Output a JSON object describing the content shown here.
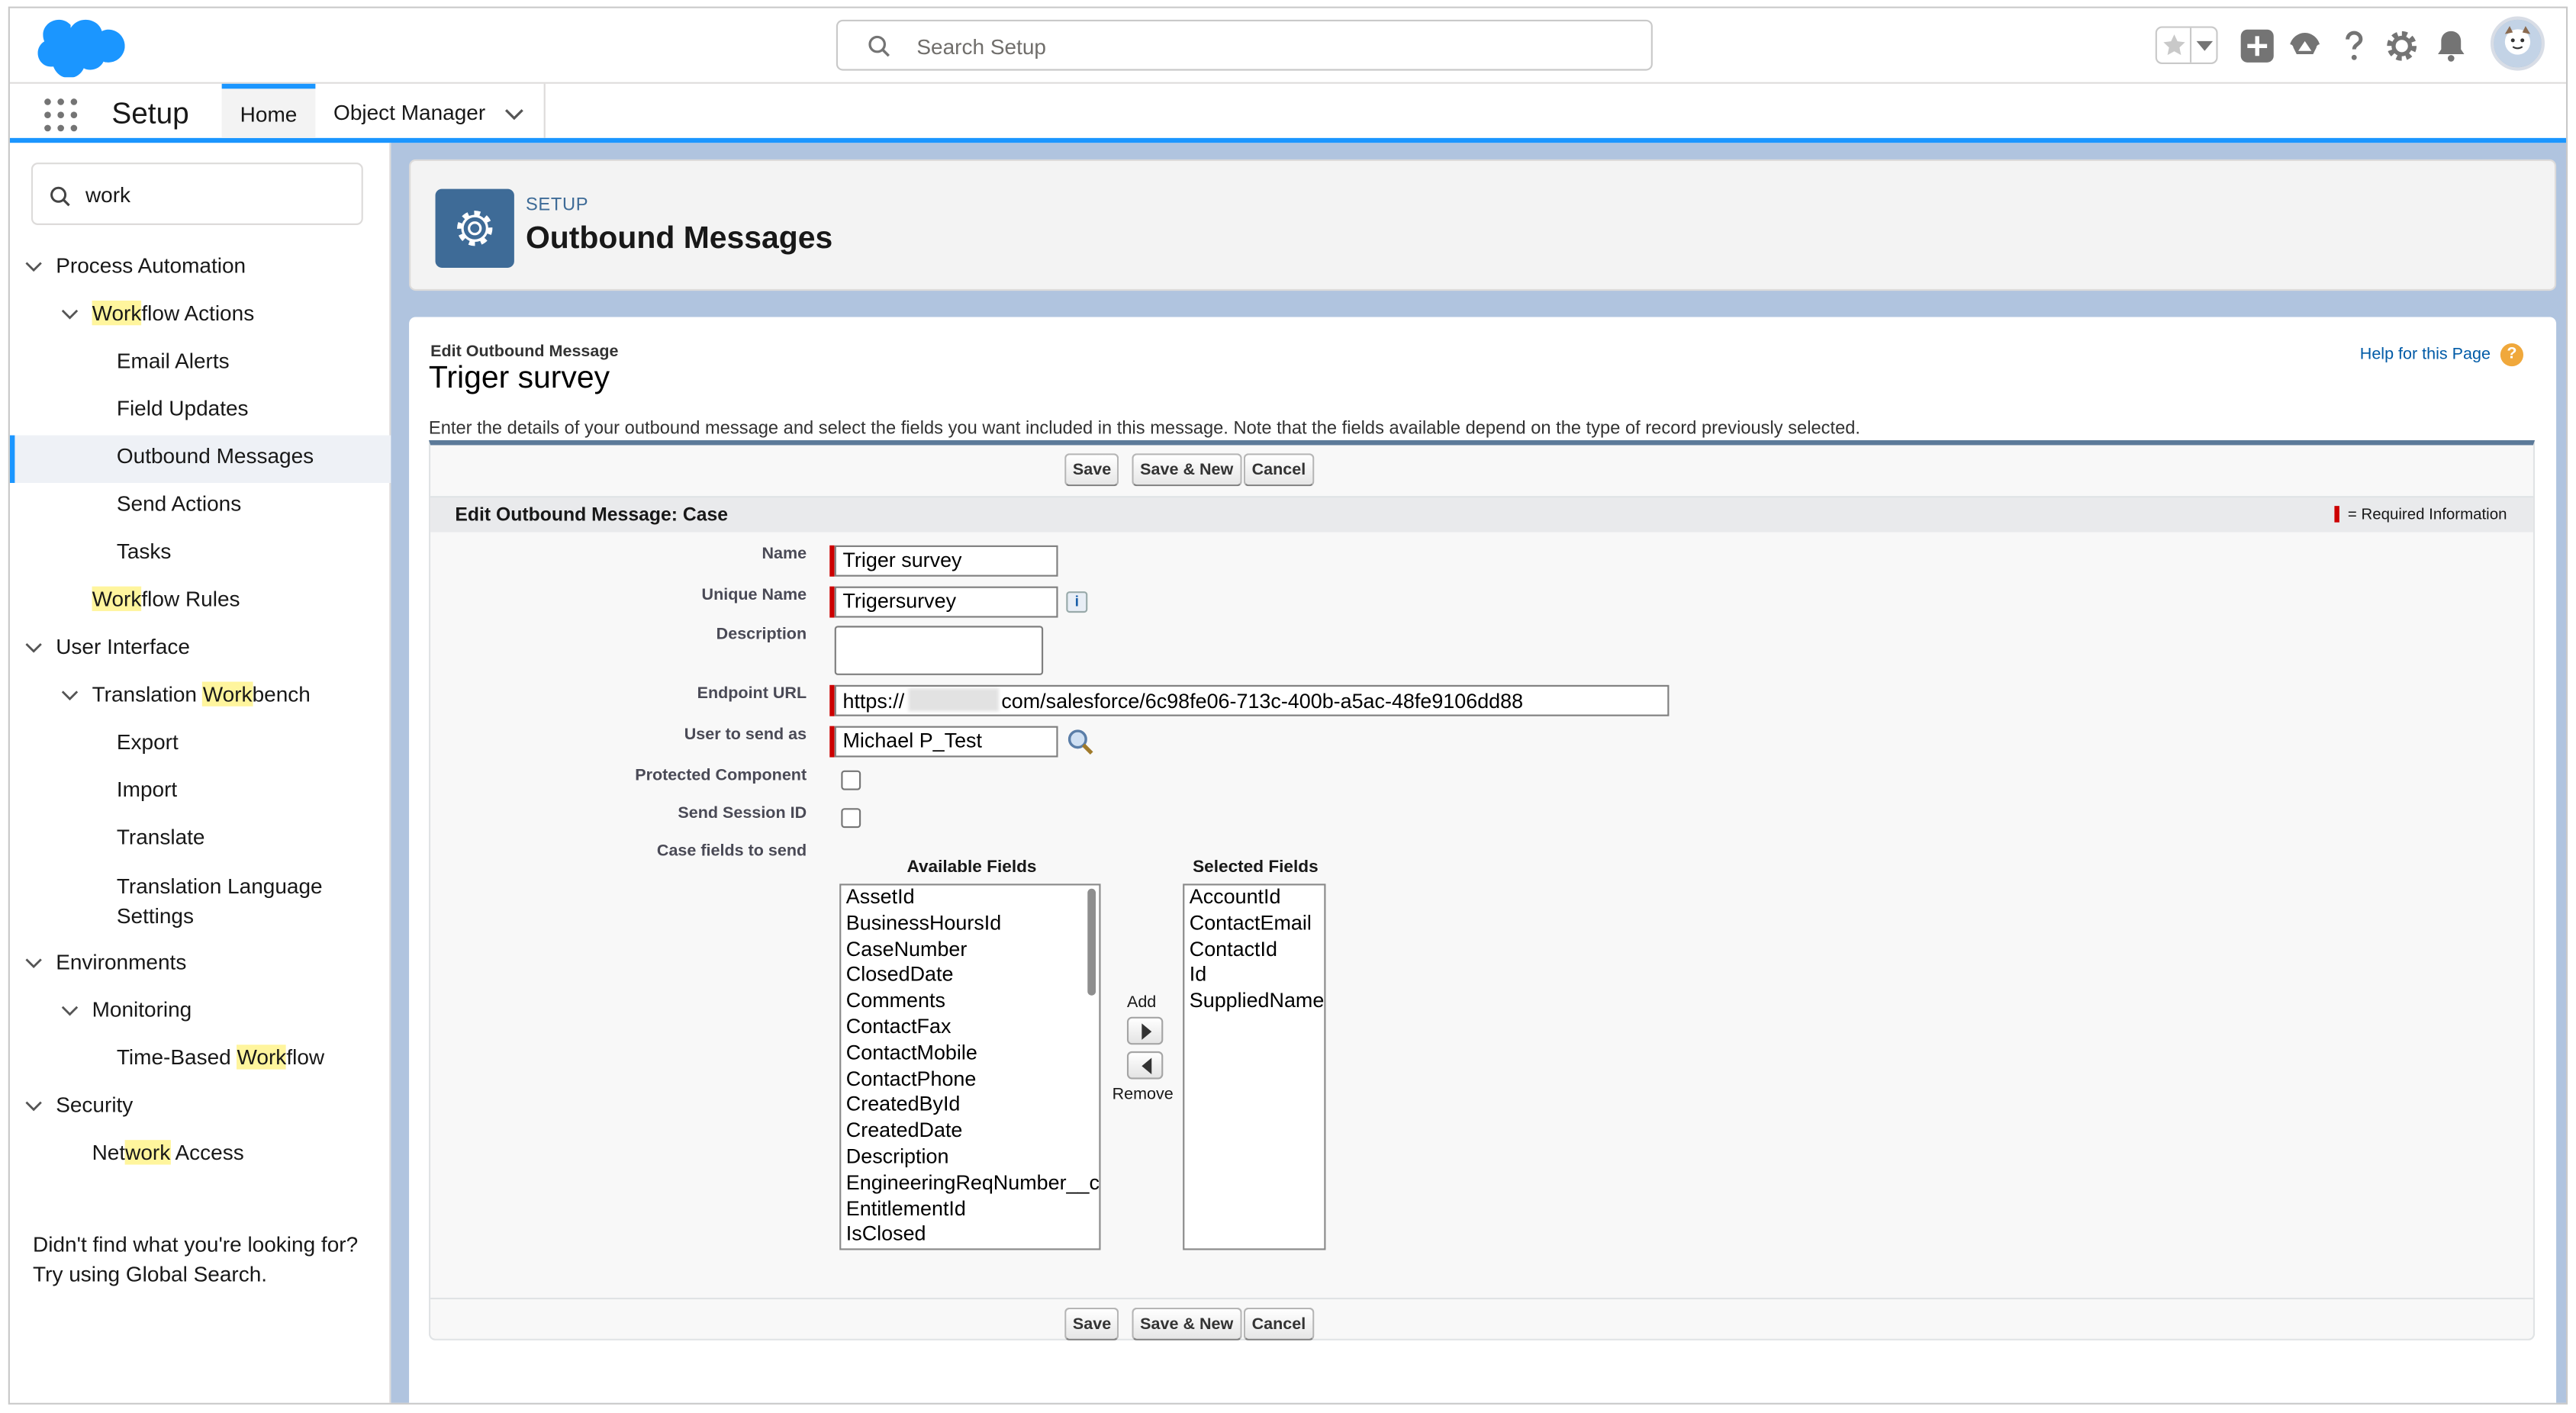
{
  "global_header": {
    "search_placeholder": "Search Setup"
  },
  "app_nav": {
    "app_name": "Setup",
    "tabs": [
      {
        "label": "Home",
        "active": true
      },
      {
        "label": "Object Manager",
        "active": false
      }
    ]
  },
  "sidebar": {
    "quick_find_value": "work",
    "tree": [
      {
        "id": "process-automation",
        "pre": "Process Automation",
        "hl": "",
        "post": "",
        "level": 0,
        "expanded": true
      },
      {
        "id": "workflow-actions",
        "pre": "",
        "hl": "Work",
        "post": "flow Actions",
        "level": 1,
        "expanded": true
      },
      {
        "id": "email-alerts",
        "pre": "Email Alerts",
        "hl": "",
        "post": "",
        "level": 2
      },
      {
        "id": "field-updates",
        "pre": "Field Updates",
        "hl": "",
        "post": "",
        "level": 2
      },
      {
        "id": "outbound-messages",
        "pre": "Outbound Messages",
        "hl": "",
        "post": "",
        "level": 2,
        "active": true
      },
      {
        "id": "send-actions",
        "pre": "Send Actions",
        "hl": "",
        "post": "",
        "level": 2
      },
      {
        "id": "tasks",
        "pre": "Tasks",
        "hl": "",
        "post": "",
        "level": 2
      },
      {
        "id": "workflow-rules",
        "pre": "",
        "hl": "Work",
        "post": "flow Rules",
        "level": 1
      },
      {
        "id": "user-interface",
        "pre": "User Interface",
        "hl": "",
        "post": "",
        "level": 0,
        "expanded": true
      },
      {
        "id": "translation-workbench",
        "pre": "Translation ",
        "hl": "Work",
        "post": "bench",
        "level": 1,
        "expanded": true
      },
      {
        "id": "export",
        "pre": "Export",
        "hl": "",
        "post": "",
        "level": 2
      },
      {
        "id": "import",
        "pre": "Import",
        "hl": "",
        "post": "",
        "level": 2
      },
      {
        "id": "translate",
        "pre": "Translate",
        "hl": "",
        "post": "",
        "level": 2
      },
      {
        "id": "translation-language-settings",
        "pre": "Translation Language",
        "hl": "",
        "post": "",
        "line2": "Settings",
        "level": 2
      },
      {
        "id": "environments",
        "pre": "Environments",
        "hl": "",
        "post": "",
        "level": 0,
        "expanded": true
      },
      {
        "id": "monitoring",
        "pre": "Monitoring",
        "hl": "",
        "post": "",
        "level": 1,
        "expanded": true
      },
      {
        "id": "time-based-workflow",
        "pre": "Time-Based ",
        "hl": "Work",
        "post": "flow",
        "level": 2
      },
      {
        "id": "security",
        "pre": "Security",
        "hl": "",
        "post": "",
        "level": 0,
        "expanded": true
      },
      {
        "id": "network-access",
        "pre": "Net",
        "hl": "work",
        "post": " Access",
        "level": 1
      }
    ],
    "footer_line1": "Didn't find what you're looking for?",
    "footer_line2": "Try using Global Search."
  },
  "page_header": {
    "crumb": "SETUP",
    "title": "Outbound Messages"
  },
  "content": {
    "pretitle": "Edit Outbound Message",
    "record_title": "Triger survey",
    "help_link": "Help for this Page",
    "help_icon": "?",
    "intro": "Enter the details of your outbound message and select the fields you want included in this message. Note that the fields available depend on the type of record previously selected.",
    "buttons": {
      "save": "Save",
      "save_new": "Save & New",
      "cancel": "Cancel"
    },
    "section_title": "Edit Outbound Message: Case",
    "required_legend": "= Required Information",
    "fields": {
      "name_label": "Name",
      "name_value": "Triger survey",
      "unique_name_label": "Unique Name",
      "unique_name_value": "Trigersurvey",
      "unique_name_info": "i",
      "description_label": "Description",
      "description_value": "",
      "endpoint_label": "Endpoint URL",
      "endpoint_prefix": "https://",
      "endpoint_suffix": "com/salesforce/6c98fe06-713c-400b-a5ac-48fe9106dd88",
      "user_label": "User to send as",
      "user_value": "Michael P_Test",
      "protected_label": "Protected Component",
      "protected_checked": false,
      "session_label": "Send Session ID",
      "session_checked": false,
      "case_fields_label": "Case fields to send"
    },
    "available_fields_header": "Available Fields",
    "selected_fields_header": "Selected Fields",
    "available_fields": [
      "AssetId",
      "BusinessHoursId",
      "CaseNumber",
      "ClosedDate",
      "Comments",
      "ContactFax",
      "ContactMobile",
      "ContactPhone",
      "CreatedById",
      "CreatedDate",
      "Description",
      "EngineeringReqNumber__c",
      "EntitlementId",
      "IsClosed"
    ],
    "selected_fields": [
      "AccountId",
      "ContactEmail",
      "ContactId",
      "Id",
      "SuppliedName"
    ],
    "add_label": "Add",
    "remove_label": "Remove"
  },
  "colors": {
    "brand_blue": "#1b96ff",
    "setup_icon_bg": "#3e6b97",
    "required_red": "#c00000",
    "main_bg": "#b0c4df"
  }
}
